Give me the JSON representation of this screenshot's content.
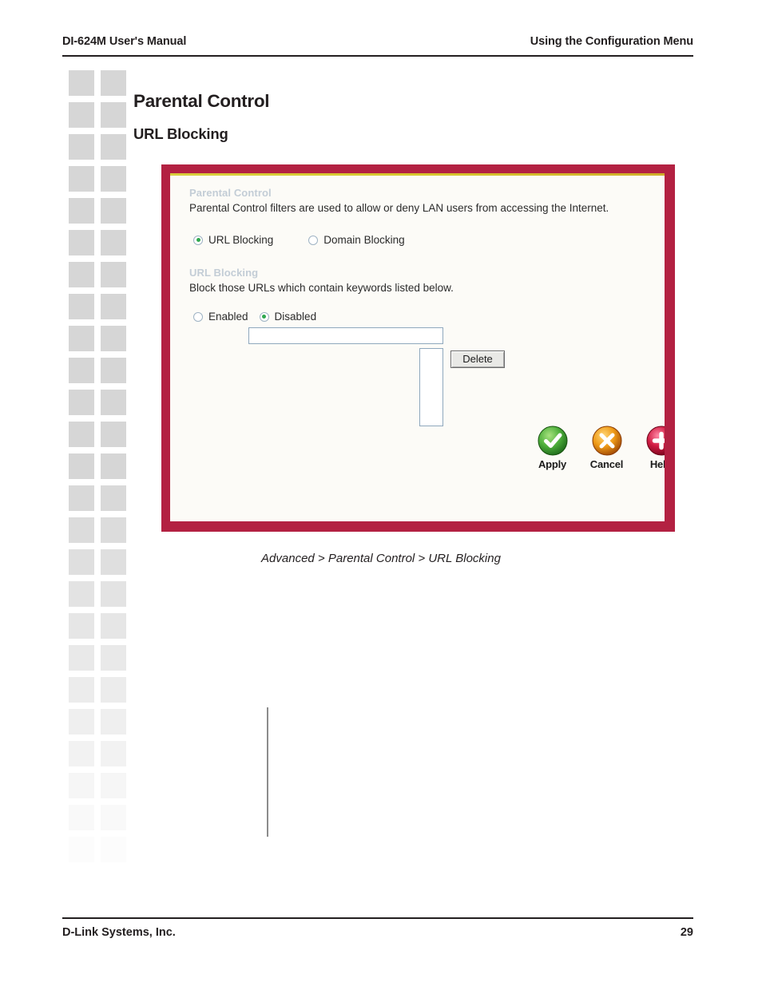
{
  "header": {
    "left": "DI-624M User's Manual",
    "right": "Using the Configuration Menu"
  },
  "headings": {
    "title": "Parental Control",
    "subtitle": "URL Blocking"
  },
  "figure": {
    "caption": "Advanced > Parental Control > URL Blocking",
    "frame_color": "#b32142",
    "accent_line_color": "#d6c72e",
    "panel_background": "#fcfbf7",
    "section_header_color": "#c3cdd6",
    "sections": [
      {
        "heading": "Parental Control",
        "description": "Parental Control filters are used to allow or deny LAN users from accessing the Internet.",
        "radios": [
          {
            "label": "URL Blocking",
            "selected": true
          },
          {
            "label": "Domain Blocking",
            "selected": false
          }
        ]
      },
      {
        "heading": "URL Blocking",
        "description": "Block those URLs which contain keywords listed below.",
        "radios": [
          {
            "label": "Enabled",
            "selected": false
          },
          {
            "label": "Disabled",
            "selected": true
          }
        ]
      }
    ],
    "keyword_input": {
      "value": "",
      "placeholder": ""
    },
    "keyword_list": {
      "items": []
    },
    "delete_button": "Delete",
    "actions": [
      {
        "label": "Apply",
        "icon": "check-circle-icon",
        "color": "#3fa535"
      },
      {
        "label": "Cancel",
        "icon": "cross-circle-icon",
        "color": "#e08a14"
      },
      {
        "label": "Help",
        "icon": "plus-circle-icon",
        "color": "#c2143c"
      }
    ]
  },
  "footer": {
    "left": "D-Link Systems, Inc.",
    "right": "29"
  }
}
